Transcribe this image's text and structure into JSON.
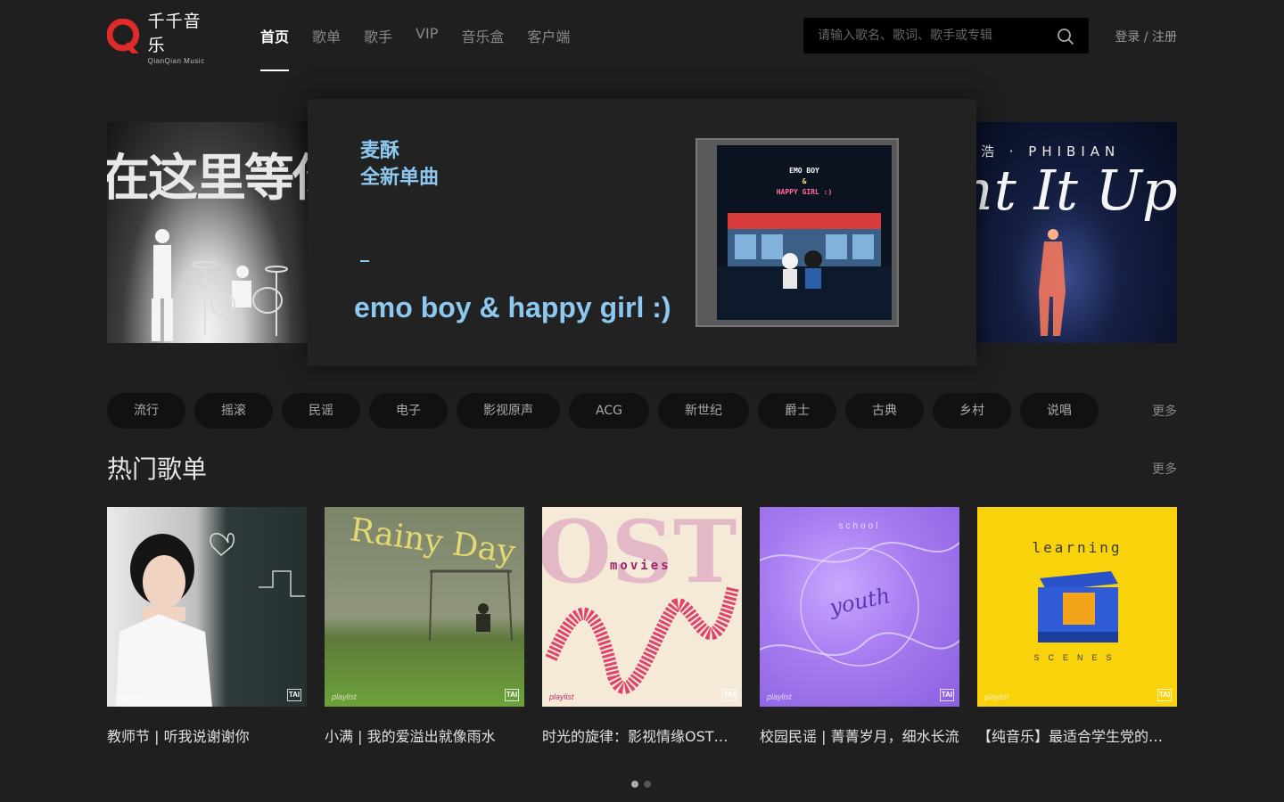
{
  "brand": {
    "name_cn": "千千音乐",
    "name_en": "QianQian Music"
  },
  "nav": [
    {
      "label": "首页",
      "active": true
    },
    {
      "label": "歌单",
      "active": false
    },
    {
      "label": "歌手",
      "active": false
    },
    {
      "label": "VIP",
      "active": false
    },
    {
      "label": "音乐盒",
      "active": false
    },
    {
      "label": "客户端",
      "active": false
    }
  ],
  "search": {
    "placeholder": "请输入歌名、歌词、歌手或专辑"
  },
  "auth": {
    "login": "登录",
    "sep": " / ",
    "register": "注册"
  },
  "banner": {
    "left_text": "在这里等你",
    "right_text_top": "浩 · PHIBIAN",
    "right_text_script": "ht It Up",
    "main": {
      "title_line1": "麦酥",
      "title_line2": "全新单曲",
      "song": "emo boy & happy girl :)",
      "album_line1": "EMO BOY",
      "album_line2": "&",
      "album_line3": "HAPPY GIRL :)"
    }
  },
  "genres": [
    "流行",
    "摇滚",
    "民谣",
    "电子",
    "影视原声",
    "ACG",
    "新世纪",
    "爵士",
    "古典",
    "乡村",
    "说唱"
  ],
  "genres_more": "更多",
  "hot": {
    "title": "热门歌单",
    "more": "更多",
    "cover_tag": "playlist",
    "cover_badge": "TAI",
    "items": [
      {
        "title": "教师节 | 听我说谢谢你",
        "cover_text": ""
      },
      {
        "title": "小满 | 我的爱溢出就像雨水",
        "cover_text": "Rainy Day"
      },
      {
        "title": "时光的旋律：影视情缘OST精选",
        "cover_text": "OST",
        "cover_sub": "movies"
      },
      {
        "title": "校园民谣 | 菁菁岁月，细水长流",
        "cover_text": "youth",
        "cover_sub": "school"
      },
      {
        "title": "【纯音乐】最适合学生党的学习歌单",
        "cover_text": "learning",
        "cover_sub": "SCENES"
      }
    ]
  },
  "pagination": {
    "pages": 2,
    "current": 1
  }
}
